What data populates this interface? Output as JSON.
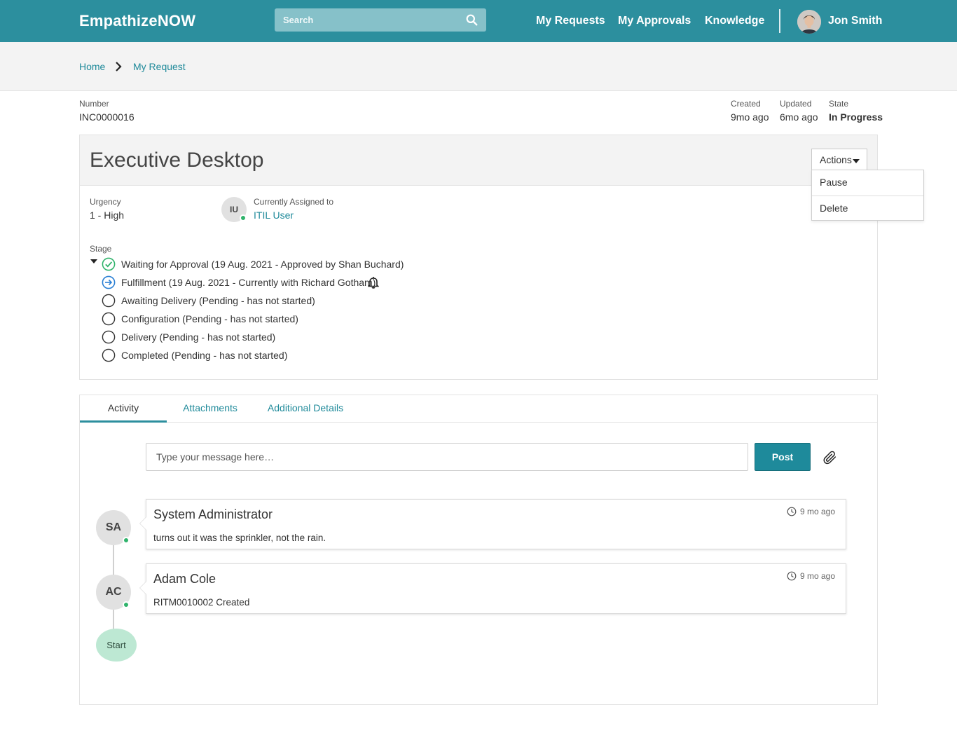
{
  "header": {
    "brand": "EmpathizeNOW",
    "search_placeholder": "Search",
    "nav": [
      "My Requests",
      "My Approvals",
      "Knowledge"
    ],
    "user_name": "Jon Smith"
  },
  "breadcrumb": {
    "home": "Home",
    "current": "My Request"
  },
  "meta": {
    "number_label": "Number",
    "number_value": "INC0000016",
    "created_label": "Created",
    "created_value": "9mo ago",
    "updated_label": "Updated",
    "updated_value": "6mo ago",
    "state_label": "State",
    "state_value": "In Progress"
  },
  "ticket": {
    "title": "Executive Desktop",
    "actions_label": "Actions",
    "actions_menu": [
      "Pause",
      "Delete"
    ],
    "urgency_label": "Urgency",
    "urgency_value": "1 - High",
    "assignee_initials": "IU",
    "assigned_label": "Currently Assigned to",
    "assigned_value": "ITIL User",
    "stage_label": "Stage",
    "stages": [
      {
        "text": "Waiting for Approval (19 Aug. 2021 - Approved by Shan Buchard)",
        "status": "completed"
      },
      {
        "text": "Fulfillment (19 Aug. 2021 - Currently with Richard Gotham)",
        "status": "in-progress"
      },
      {
        "text": "Awaiting Delivery (Pending - has not started)",
        "status": "pending"
      },
      {
        "text": "Configuration (Pending - has not started)",
        "status": "pending"
      },
      {
        "text": "Delivery (Pending - has not started)",
        "status": "pending"
      },
      {
        "text": "Completed (Pending - has not started)",
        "status": "pending"
      }
    ]
  },
  "tabs": [
    "Activity",
    "Attachments",
    "Additional Details"
  ],
  "activity": {
    "input_placeholder": "Type your message here…",
    "post_label": "Post",
    "entries": [
      {
        "initials": "SA",
        "author": "System Administrator",
        "time": "9 mo ago",
        "text": "turns out it was the sprinkler, not the rain."
      },
      {
        "initials": "AC",
        "author": "Adam Cole",
        "time": "9 mo ago",
        "text": "RITM0010002 Created"
      }
    ],
    "start_label": "Start"
  },
  "colors": {
    "brand": "#2c8f9e",
    "link": "#1f8a9a",
    "online": "#2fb36b",
    "completed": "#2fb36b",
    "in_progress": "#2a7fd4"
  },
  "icons": [
    "search-icon",
    "chevron-right-icon",
    "check-circle-icon",
    "arrow-circle-icon",
    "circle-icon",
    "bell-icon",
    "paperclip-icon",
    "clock-icon",
    "caret-down-icon"
  ]
}
